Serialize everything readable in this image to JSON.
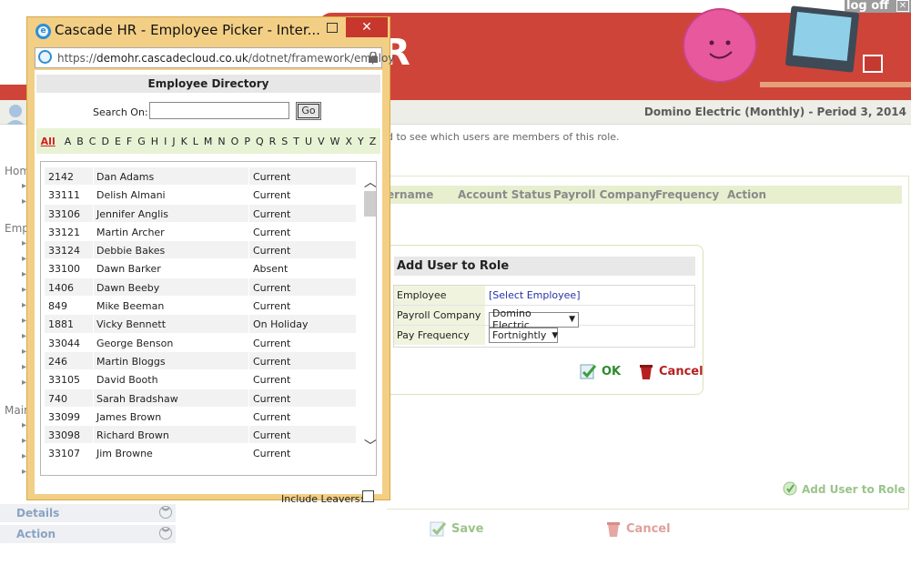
{
  "app": {
    "logoff_label": "log off",
    "company_period": "Domino Electric (Monthly) - Period 3, 2014",
    "banner_letter": "R",
    "hint_text": "d to see which users are members of this role."
  },
  "sidebar": {
    "items": [
      "Hom",
      "Emp",
      "Main"
    ],
    "tabs": [
      {
        "label": "Details"
      },
      {
        "label": "Action"
      }
    ]
  },
  "grid": {
    "columns": [
      "ername",
      "Account Status",
      "Payroll Company",
      "Frequency",
      "Action"
    ]
  },
  "add_dialog": {
    "title": "Add User to Role",
    "employee_label": "Employee",
    "employee_value": "[Select Employee]",
    "payroll_label": "Payroll Company",
    "payroll_value": "Domino Electric",
    "frequency_label": "Pay Frequency",
    "frequency_value": "Fortnightly",
    "ok_label": "OK",
    "cancel_label": "Cancel"
  },
  "bottom_actions": {
    "add_user_role": "Add User to Role",
    "save": "Save",
    "cancel": "Cancel"
  },
  "popup": {
    "window_title": "Cascade HR - Employee Picker - Inter...",
    "url_prefix": "https://",
    "url_domain": "demohr.cascadecloud.co.uk",
    "url_path": "/dotnet/framework/employ",
    "directory_title": "Employee Directory",
    "search_label": "Search On:",
    "search_value": "",
    "go_label": "Go",
    "alphabet": [
      "All",
      "A",
      "B",
      "C",
      "D",
      "E",
      "F",
      "G",
      "H",
      "I",
      "J",
      "K",
      "L",
      "M",
      "N",
      "O",
      "P",
      "Q",
      "R",
      "S",
      "T",
      "U",
      "V",
      "W",
      "X",
      "Y",
      "Z"
    ],
    "employees": [
      {
        "id": "2142",
        "name": "Dan Adams",
        "status": "Current"
      },
      {
        "id": "33111",
        "name": "Delish Almani",
        "status": "Current"
      },
      {
        "id": "33106",
        "name": "Jennifer Anglis",
        "status": "Current"
      },
      {
        "id": "33121",
        "name": "Martin Archer",
        "status": "Current"
      },
      {
        "id": "33124",
        "name": "Debbie Bakes",
        "status": "Current"
      },
      {
        "id": "33100",
        "name": "Dawn Barker",
        "status": "Absent"
      },
      {
        "id": "1406",
        "name": "Dawn Beeby",
        "status": "Current"
      },
      {
        "id": "849",
        "name": "Mike Beeman",
        "status": "Current"
      },
      {
        "id": "1881",
        "name": "Vicky Bennett",
        "status": "On Holiday"
      },
      {
        "id": "33044",
        "name": "George Benson",
        "status": "Current"
      },
      {
        "id": "246",
        "name": "Martin Bloggs",
        "status": "Current"
      },
      {
        "id": "33105",
        "name": "David Booth",
        "status": "Current"
      },
      {
        "id": "740",
        "name": "Sarah Bradshaw",
        "status": "Current"
      },
      {
        "id": "33099",
        "name": "James Brown",
        "status": "Current"
      },
      {
        "id": "33098",
        "name": "Richard Brown",
        "status": "Current"
      },
      {
        "id": "33107",
        "name": "Jim Browne",
        "status": "Current"
      }
    ],
    "include_leavers_label": "Include Leavers:",
    "include_leavers_checked": false
  }
}
